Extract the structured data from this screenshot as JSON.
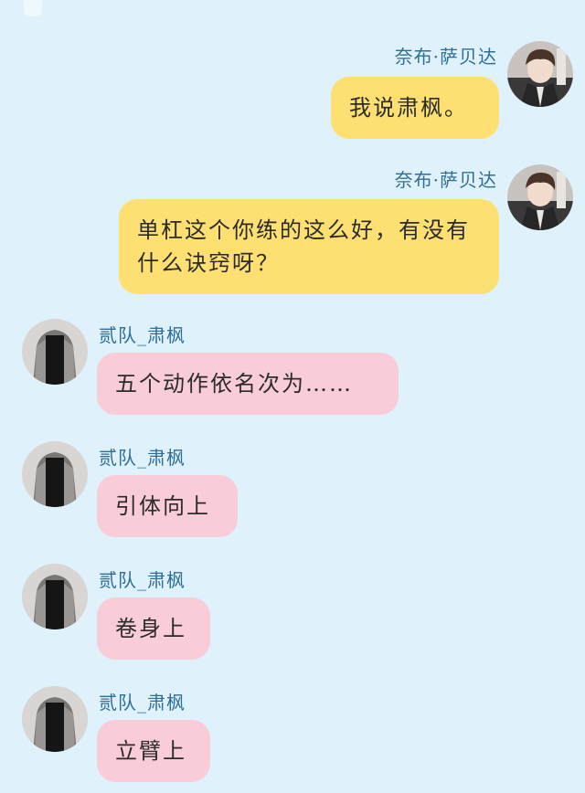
{
  "messages": [
    {
      "sender": "奈布·萨贝达",
      "text": "我说肃枫。"
    },
    {
      "sender": "奈布·萨贝达",
      "text": "单杠这个你练的这么好，有没有什么诀窍呀？"
    },
    {
      "sender": "贰队_肃枫",
      "text": "五个动作依名次为……"
    },
    {
      "sender": "贰队_肃枫",
      "text": "引体向上"
    },
    {
      "sender": "贰队_肃枫",
      "text": "卷身上"
    },
    {
      "sender": "贰队_肃枫",
      "text": "立臂上"
    }
  ],
  "colors": {
    "background": "#dff1fb",
    "self_bubble": "#fde071",
    "other_bubble": "#f9cdd8",
    "name_text": "#2f6f96"
  },
  "icons": {
    "self_avatar": "anime-boy-avatar-icon",
    "other_avatar": "dark-outfit-figure-avatar-icon"
  }
}
